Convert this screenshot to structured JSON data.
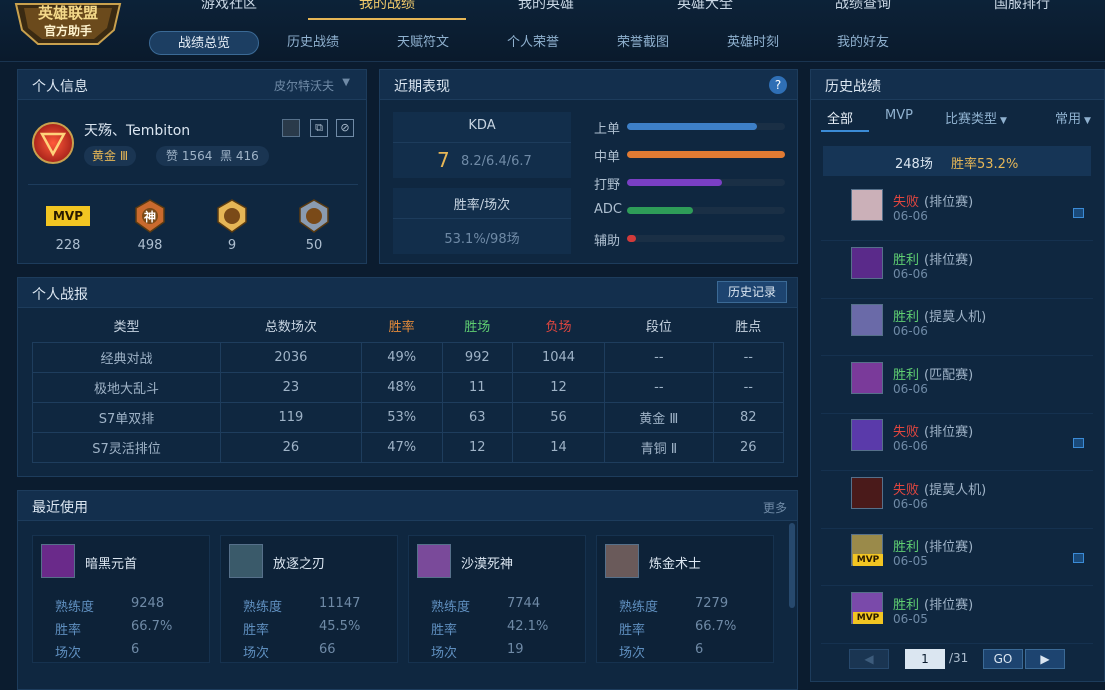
{
  "header": {
    "logo_line1": "英雄联盟",
    "logo_line2": "官方助手",
    "nav": [
      {
        "label": "游戏社区"
      },
      {
        "label": "我的战绩"
      },
      {
        "label": "我的英雄"
      },
      {
        "label": "英雄大全"
      },
      {
        "label": "战绩查询"
      },
      {
        "label": "国服排行"
      }
    ],
    "active_nav": "我的战绩",
    "subnav": [
      {
        "label": "战绩总览"
      },
      {
        "label": "历史战绩"
      },
      {
        "label": "天赋符文"
      },
      {
        "label": "个人荣誉"
      },
      {
        "label": "荣誉截图"
      },
      {
        "label": "英雄时刻"
      },
      {
        "label": "我的好友"
      }
    ],
    "active_subnav": "战绩总览"
  },
  "profile": {
    "title": "个人信息",
    "server": "皮尔特沃夫",
    "name": "天殇、Tembiton",
    "rank": "黄金 Ⅲ",
    "likes": "赞 1564",
    "blacks": "黑 416",
    "honors": [
      {
        "label": "MVP",
        "count": "228"
      },
      {
        "label": "神",
        "count": "498"
      },
      {
        "label": "",
        "count": "9"
      },
      {
        "label": "",
        "count": "50"
      }
    ]
  },
  "recent": {
    "title": "近期表现",
    "help": "?",
    "kda_label": "KDA",
    "kda_value": "7",
    "kda_detail": "8.2/6.4/6.7",
    "winrate_label": "胜率/场次",
    "winrate_value": "53.1%/98场",
    "lanes": [
      {
        "name": "上单",
        "value": 0.82,
        "color": "#3d7fc7"
      },
      {
        "name": "中单",
        "value": 1.0,
        "color": "#e07a33"
      },
      {
        "name": "打野",
        "value": 0.6,
        "color": "#7a3fc4"
      },
      {
        "name": "ADC",
        "value": 0.42,
        "color": "#2e9c58"
      },
      {
        "name": "辅助",
        "value": 0.06,
        "color": "#d23a3a"
      }
    ]
  },
  "report": {
    "title": "个人战报",
    "history_button": "历史记录",
    "headers": [
      "类型",
      "总数场次",
      "胜率",
      "胜场",
      "负场",
      "段位",
      "胜点"
    ],
    "header_colors": [
      "#c7d4e1",
      "#c7d4e1",
      "#e28a3a",
      "#5fcf72",
      "#e0463f",
      "#c7d4e1",
      "#c7d4e1"
    ],
    "rows": [
      [
        "经典对战",
        "2036",
        "49%",
        "992",
        "1044",
        "--",
        "--"
      ],
      [
        "极地大乱斗",
        "23",
        "48%",
        "11",
        "12",
        "--",
        "--"
      ],
      [
        "S7单双排",
        "119",
        "53%",
        "63",
        "56",
        "黄金 Ⅲ",
        "82"
      ],
      [
        "S7灵活排位",
        "26",
        "47%",
        "12",
        "14",
        "青铜 Ⅱ",
        "26"
      ]
    ]
  },
  "used": {
    "title": "最近使用",
    "more": "更多",
    "heroes": [
      {
        "name": "暗黑元首",
        "prof_label": "熟练度",
        "prof": "9248",
        "wr_label": "胜率",
        "wr": "66.7%",
        "games_label": "场次",
        "games": "6"
      },
      {
        "name": "放逐之刃",
        "prof_label": "熟练度",
        "prof": "11147",
        "wr_label": "胜率",
        "wr": "45.5%",
        "games_label": "场次",
        "games": "66"
      },
      {
        "name": "沙漠死神",
        "prof_label": "熟练度",
        "prof": "7744",
        "wr_label": "胜率",
        "wr": "42.1%",
        "games_label": "场次",
        "games": "19"
      },
      {
        "name": "炼金术士",
        "prof_label": "熟练度",
        "prof": "7279",
        "wr_label": "胜率",
        "wr": "66.7%",
        "games_label": "场次",
        "games": "6"
      }
    ]
  },
  "history": {
    "title": "历史战绩",
    "tabs": [
      {
        "label": "全部"
      },
      {
        "label": "MVP"
      },
      {
        "label": "比赛类型"
      },
      {
        "label": "常用"
      }
    ],
    "summary_games": "248场",
    "summary_wr": "胜率53.2%",
    "matches": [
      {
        "result": "失败",
        "mode": "(排位赛)",
        "date": "06-06",
        "mvp": false,
        "flag": true
      },
      {
        "result": "胜利",
        "mode": "(排位赛)",
        "date": "06-06",
        "mvp": false,
        "flag": false
      },
      {
        "result": "胜利",
        "mode": "(提莫人机)",
        "date": "06-06",
        "mvp": false,
        "flag": false
      },
      {
        "result": "胜利",
        "mode": "(匹配赛)",
        "date": "06-06",
        "mvp": false,
        "flag": false
      },
      {
        "result": "失败",
        "mode": "(排位赛)",
        "date": "06-06",
        "mvp": false,
        "flag": true
      },
      {
        "result": "失败",
        "mode": "(提莫人机)",
        "date": "06-06",
        "mvp": false,
        "flag": false
      },
      {
        "result": "胜利",
        "mode": "(排位赛)",
        "date": "06-05",
        "mvp": true,
        "flag": true
      },
      {
        "result": "胜利",
        "mode": "(排位赛)",
        "date": "06-05",
        "mvp": true,
        "flag": false
      }
    ],
    "mvp_badge": "MVP",
    "page_value": "1",
    "page_total": "/31",
    "go_label": "GO"
  }
}
